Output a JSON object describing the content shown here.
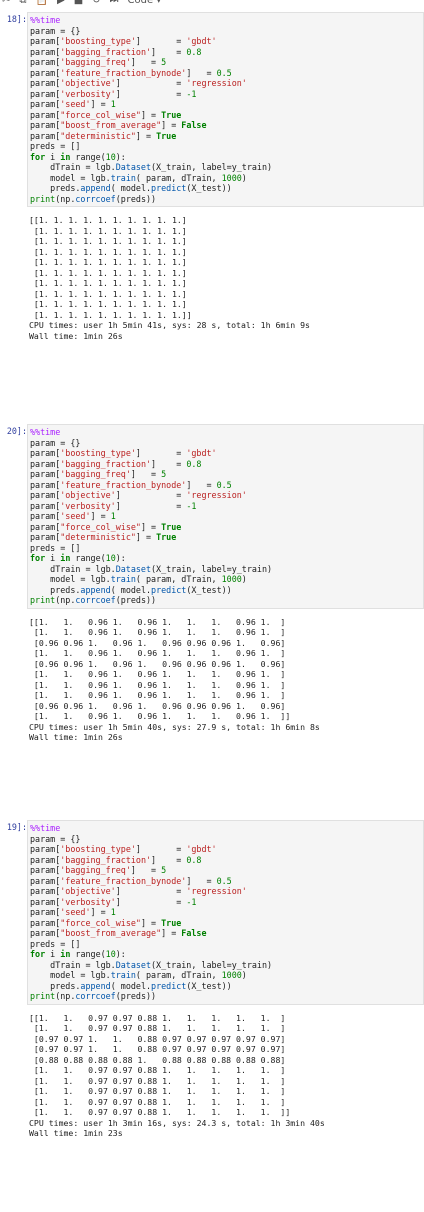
{
  "toolbar": {
    "items": [
      {
        "name": "cut-icon",
        "glyph": "✂"
      },
      {
        "name": "copy-icon",
        "glyph": "⧉"
      },
      {
        "name": "paste-icon",
        "glyph": "📋"
      },
      {
        "name": "run-icon",
        "glyph": "▶"
      },
      {
        "name": "stop-icon",
        "glyph": "■"
      },
      {
        "name": "restart-icon",
        "glyph": "↻"
      },
      {
        "name": "fast-forward-icon",
        "glyph": "⏭"
      },
      {
        "name": "cell-type-select",
        "glyph": "Code  ▾"
      }
    ]
  },
  "cells": [
    {
      "prompt": "18]:",
      "code": [
        [
          {
            "t": "%%time",
            "c": "m"
          }
        ],
        [
          {
            "t": "param = {}"
          }
        ],
        [
          {
            "t": "param["
          },
          {
            "t": "'boosting_type'",
            "c": "s"
          },
          {
            "t": "]       = "
          },
          {
            "t": "'gbdt'",
            "c": "s"
          }
        ],
        [
          {
            "t": "param["
          },
          {
            "t": "'bagging_fraction'",
            "c": "s"
          },
          {
            "t": "]    = "
          },
          {
            "t": "0.8",
            "c": "n"
          }
        ],
        [
          {
            "t": "param["
          },
          {
            "t": "'bagging_freq'",
            "c": "s"
          },
          {
            "t": "]   = "
          },
          {
            "t": "5",
            "c": "n"
          }
        ],
        [
          {
            "t": "param["
          },
          {
            "t": "'feature_fraction_bynode'",
            "c": "s"
          },
          {
            "t": "]   = "
          },
          {
            "t": "0.5",
            "c": "n"
          }
        ],
        [
          {
            "t": "param["
          },
          {
            "t": "'objective'",
            "c": "s"
          },
          {
            "t": "]           = "
          },
          {
            "t": "'regression'",
            "c": "s"
          }
        ],
        [
          {
            "t": "param["
          },
          {
            "t": "'verbosity'",
            "c": "s"
          },
          {
            "t": "]           = "
          },
          {
            "t": "-1",
            "c": "n"
          }
        ],
        [
          {
            "t": "param["
          },
          {
            "t": "'seed'",
            "c": "s"
          },
          {
            "t": "] = "
          },
          {
            "t": "1",
            "c": "n"
          }
        ],
        [
          {
            "t": "param["
          },
          {
            "t": "\"force_col_wise\"",
            "c": "s"
          },
          {
            "t": "] = "
          },
          {
            "t": "True",
            "c": "k"
          }
        ],
        [
          {
            "t": "param["
          },
          {
            "t": "\"boost_from_average\"",
            "c": "s"
          },
          {
            "t": "] = "
          },
          {
            "t": "False",
            "c": "k"
          }
        ],
        [
          {
            "t": "param["
          },
          {
            "t": "\"deterministic\"",
            "c": "s"
          },
          {
            "t": "] = "
          },
          {
            "t": "True",
            "c": "k"
          }
        ],
        [
          {
            "t": "preds = []"
          }
        ],
        [
          {
            "t": "for",
            "c": "k"
          },
          {
            "t": " i "
          },
          {
            "t": "in",
            "c": "k"
          },
          {
            "t": " range("
          },
          {
            "t": "10",
            "c": "n"
          },
          {
            "t": "):"
          }
        ],
        [
          {
            "t": "    dTrain = lgb."
          },
          {
            "t": "Dataset",
            "c": "f"
          },
          {
            "t": "(X_train, label=y_train)"
          }
        ],
        [
          {
            "t": "    model = lgb."
          },
          {
            "t": "train",
            "c": "f"
          },
          {
            "t": "( param, dTrain, "
          },
          {
            "t": "1000",
            "c": "n"
          },
          {
            "t": ")"
          }
        ],
        [
          {
            "t": "    preds."
          },
          {
            "t": "append",
            "c": "f"
          },
          {
            "t": "( model."
          },
          {
            "t": "predict",
            "c": "f"
          },
          {
            "t": "(X_test))"
          }
        ],
        [
          {
            "t": "print",
            "c": "n"
          },
          {
            "t": "(np."
          },
          {
            "t": "corrcoef",
            "c": "f"
          },
          {
            "t": "(preds))"
          }
        ]
      ],
      "output": [
        "[[1. 1. 1. 1. 1. 1. 1. 1. 1. 1.]",
        " [1. 1. 1. 1. 1. 1. 1. 1. 1. 1.]",
        " [1. 1. 1. 1. 1. 1. 1. 1. 1. 1.]",
        " [1. 1. 1. 1. 1. 1. 1. 1. 1. 1.]",
        " [1. 1. 1. 1. 1. 1. 1. 1. 1. 1.]",
        " [1. 1. 1. 1. 1. 1. 1. 1. 1. 1.]",
        " [1. 1. 1. 1. 1. 1. 1. 1. 1. 1.]",
        " [1. 1. 1. 1. 1. 1. 1. 1. 1. 1.]",
        " [1. 1. 1. 1. 1. 1. 1. 1. 1. 1.]",
        " [1. 1. 1. 1. 1. 1. 1. 1. 1. 1.]]",
        "CPU times: user 1h 5min 41s, sys: 28 s, total: 1h 6min 9s",
        "Wall time: 1min 26s"
      ]
    },
    {
      "prompt": "20]:",
      "code": [
        [
          {
            "t": "%%time",
            "c": "m"
          }
        ],
        [
          {
            "t": "param = {}"
          }
        ],
        [
          {
            "t": "param["
          },
          {
            "t": "'boosting_type'",
            "c": "s"
          },
          {
            "t": "]       = "
          },
          {
            "t": "'gbdt'",
            "c": "s"
          }
        ],
        [
          {
            "t": "param["
          },
          {
            "t": "'bagging_fraction'",
            "c": "s"
          },
          {
            "t": "]    = "
          },
          {
            "t": "0.8",
            "c": "n"
          }
        ],
        [
          {
            "t": "param["
          },
          {
            "t": "'bagging_freq'",
            "c": "s"
          },
          {
            "t": "]   = "
          },
          {
            "t": "5",
            "c": "n"
          }
        ],
        [
          {
            "t": "param["
          },
          {
            "t": "'feature_fraction_bynode'",
            "c": "s"
          },
          {
            "t": "]   = "
          },
          {
            "t": "0.5",
            "c": "n"
          }
        ],
        [
          {
            "t": "param["
          },
          {
            "t": "'objective'",
            "c": "s"
          },
          {
            "t": "]           = "
          },
          {
            "t": "'regression'",
            "c": "s"
          }
        ],
        [
          {
            "t": "param["
          },
          {
            "t": "'verbosity'",
            "c": "s"
          },
          {
            "t": "]           = "
          },
          {
            "t": "-1",
            "c": "n"
          }
        ],
        [
          {
            "t": "param["
          },
          {
            "t": "'seed'",
            "c": "s"
          },
          {
            "t": "] = "
          },
          {
            "t": "1",
            "c": "n"
          }
        ],
        [
          {
            "t": "param["
          },
          {
            "t": "\"force_col_wise\"",
            "c": "s"
          },
          {
            "t": "] = "
          },
          {
            "t": "True",
            "c": "k"
          }
        ],
        [
          {
            "t": "param["
          },
          {
            "t": "\"deterministic\"",
            "c": "s"
          },
          {
            "t": "] = "
          },
          {
            "t": "True",
            "c": "k"
          }
        ],
        [
          {
            "t": "preds = []"
          }
        ],
        [
          {
            "t": "for",
            "c": "k"
          },
          {
            "t": " i "
          },
          {
            "t": "in",
            "c": "k"
          },
          {
            "t": " range("
          },
          {
            "t": "10",
            "c": "n"
          },
          {
            "t": "):"
          }
        ],
        [
          {
            "t": "    dTrain = lgb."
          },
          {
            "t": "Dataset",
            "c": "f"
          },
          {
            "t": "(X_train, label=y_train)"
          }
        ],
        [
          {
            "t": "    model = lgb."
          },
          {
            "t": "train",
            "c": "f"
          },
          {
            "t": "( param, dTrain, "
          },
          {
            "t": "1000",
            "c": "n"
          },
          {
            "t": ")"
          }
        ],
        [
          {
            "t": "    preds."
          },
          {
            "t": "append",
            "c": "f"
          },
          {
            "t": "( model."
          },
          {
            "t": "predict",
            "c": "f"
          },
          {
            "t": "(X_test))"
          }
        ],
        [
          {
            "t": "print",
            "c": "n"
          },
          {
            "t": "(np."
          },
          {
            "t": "corrcoef",
            "c": "f"
          },
          {
            "t": "(preds))"
          }
        ]
      ],
      "output": [
        "[[1.   1.   0.96 1.   0.96 1.   1.   1.   0.96 1.  ]",
        " [1.   1.   0.96 1.   0.96 1.   1.   1.   0.96 1.  ]",
        " [0.96 0.96 1.   0.96 1.   0.96 0.96 0.96 1.   0.96]",
        " [1.   1.   0.96 1.   0.96 1.   1.   1.   0.96 1.  ]",
        " [0.96 0.96 1.   0.96 1.   0.96 0.96 0.96 1.   0.96]",
        " [1.   1.   0.96 1.   0.96 1.   1.   1.   0.96 1.  ]",
        " [1.   1.   0.96 1.   0.96 1.   1.   1.   0.96 1.  ]",
        " [1.   1.   0.96 1.   0.96 1.   1.   1.   0.96 1.  ]",
        " [0.96 0.96 1.   0.96 1.   0.96 0.96 0.96 1.   0.96]",
        " [1.   1.   0.96 1.   0.96 1.   1.   1.   0.96 1.  ]]",
        "CPU times: user 1h 5min 40s, sys: 27.9 s, total: 1h 6min 8s",
        "Wall time: 1min 26s"
      ]
    },
    {
      "prompt": "19]:",
      "code": [
        [
          {
            "t": "%%time",
            "c": "m"
          }
        ],
        [
          {
            "t": "param = {}"
          }
        ],
        [
          {
            "t": "param["
          },
          {
            "t": "'boosting_type'",
            "c": "s"
          },
          {
            "t": "]       = "
          },
          {
            "t": "'gbdt'",
            "c": "s"
          }
        ],
        [
          {
            "t": "param["
          },
          {
            "t": "'bagging_fraction'",
            "c": "s"
          },
          {
            "t": "]    = "
          },
          {
            "t": "0.8",
            "c": "n"
          }
        ],
        [
          {
            "t": "param["
          },
          {
            "t": "'bagging_freq'",
            "c": "s"
          },
          {
            "t": "]   = "
          },
          {
            "t": "5",
            "c": "n"
          }
        ],
        [
          {
            "t": "param["
          },
          {
            "t": "'feature_fraction_bynode'",
            "c": "s"
          },
          {
            "t": "]   = "
          },
          {
            "t": "0.5",
            "c": "n"
          }
        ],
        [
          {
            "t": "param["
          },
          {
            "t": "'objective'",
            "c": "s"
          },
          {
            "t": "]           = "
          },
          {
            "t": "'regression'",
            "c": "s"
          }
        ],
        [
          {
            "t": "param["
          },
          {
            "t": "'verbosity'",
            "c": "s"
          },
          {
            "t": "]           = "
          },
          {
            "t": "-1",
            "c": "n"
          }
        ],
        [
          {
            "t": "param["
          },
          {
            "t": "'seed'",
            "c": "s"
          },
          {
            "t": "] = "
          },
          {
            "t": "1",
            "c": "n"
          }
        ],
        [
          {
            "t": "param["
          },
          {
            "t": "\"force_col_wise\"",
            "c": "s"
          },
          {
            "t": "] = "
          },
          {
            "t": "True",
            "c": "k"
          }
        ],
        [
          {
            "t": "param["
          },
          {
            "t": "\"boost_from_average\"",
            "c": "s"
          },
          {
            "t": "] = "
          },
          {
            "t": "False",
            "c": "k"
          }
        ],
        [
          {
            "t": "preds = []"
          }
        ],
        [
          {
            "t": "for",
            "c": "k"
          },
          {
            "t": " i "
          },
          {
            "t": "in",
            "c": "k"
          },
          {
            "t": " range("
          },
          {
            "t": "10",
            "c": "n"
          },
          {
            "t": "):"
          }
        ],
        [
          {
            "t": "    dTrain = lgb."
          },
          {
            "t": "Dataset",
            "c": "f"
          },
          {
            "t": "(X_train, label=y_train)"
          }
        ],
        [
          {
            "t": "    model = lgb."
          },
          {
            "t": "train",
            "c": "f"
          },
          {
            "t": "( param, dTrain, "
          },
          {
            "t": "1000",
            "c": "n"
          },
          {
            "t": ")"
          }
        ],
        [
          {
            "t": "    preds."
          },
          {
            "t": "append",
            "c": "f"
          },
          {
            "t": "( model."
          },
          {
            "t": "predict",
            "c": "f"
          },
          {
            "t": "(X_test))"
          }
        ],
        [
          {
            "t": "print",
            "c": "n"
          },
          {
            "t": "(np."
          },
          {
            "t": "corrcoef",
            "c": "f"
          },
          {
            "t": "(preds))"
          }
        ]
      ],
      "output": [
        "[[1.   1.   0.97 0.97 0.88 1.   1.   1.   1.   1.  ]",
        " [1.   1.   0.97 0.97 0.88 1.   1.   1.   1.   1.  ]",
        " [0.97 0.97 1.   1.   0.88 0.97 0.97 0.97 0.97 0.97]",
        " [0.97 0.97 1.   1.   0.88 0.97 0.97 0.97 0.97 0.97]",
        " [0.88 0.88 0.88 0.88 1.   0.88 0.88 0.88 0.88 0.88]",
        " [1.   1.   0.97 0.97 0.88 1.   1.   1.   1.   1.  ]",
        " [1.   1.   0.97 0.97 0.88 1.   1.   1.   1.   1.  ]",
        " [1.   1.   0.97 0.97 0.88 1.   1.   1.   1.   1.  ]",
        " [1.   1.   0.97 0.97 0.88 1.   1.   1.   1.   1.  ]",
        " [1.   1.   0.97 0.97 0.88 1.   1.   1.   1.   1.  ]]",
        "CPU times: user 1h 3min 16s, sys: 24.3 s, total: 1h 3min 40s",
        "Wall time: 1min 23s"
      ]
    }
  ]
}
